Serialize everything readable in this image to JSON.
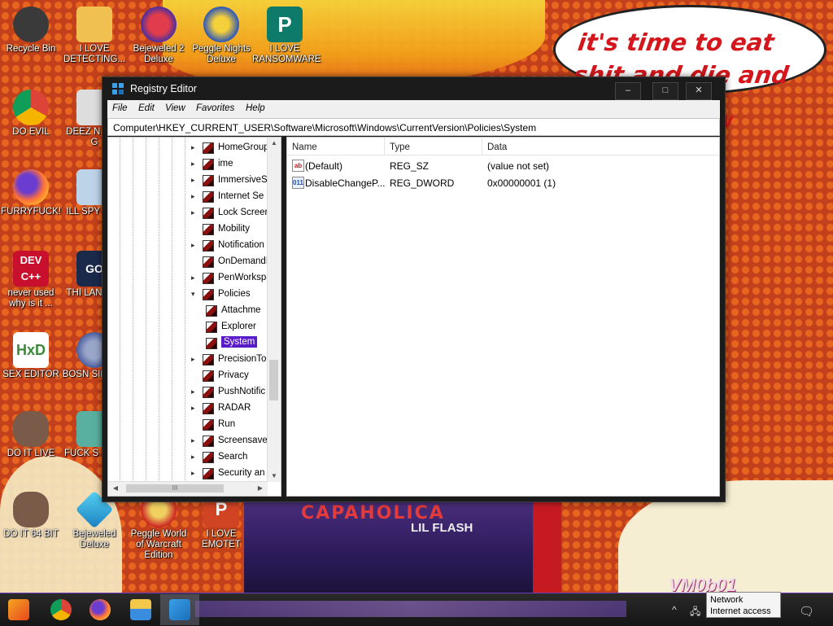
{
  "wallpaper": {
    "speech_bubble": "it's time to eat shit and die and chew",
    "speech_bubble_tail": "w",
    "poster_title": "CAPAHOLICA",
    "poster_subtitle": "LIL FLASH",
    "vm_label": "VM0b01"
  },
  "desktop_icons": [
    {
      "label": "Recycle Bin",
      "icon": "recycle-bin-icon"
    },
    {
      "label": "I LOVE DETECTING...",
      "icon": "detect-icon"
    },
    {
      "label": "Bejeweled 2 Deluxe",
      "icon": "bejeweled-icon"
    },
    {
      "label": "Peggle Nights Deluxe",
      "icon": "peggle-icon"
    },
    {
      "label": "I LOVE RANSOMWARE",
      "icon": "publisher-icon"
    },
    {
      "label": "DO EVIL",
      "icon": "chrome-icon"
    },
    {
      "label": "DEEZ N HAH G",
      "icon": "file-icon"
    },
    {
      "label": "FURRYFUCK!",
      "icon": "firefox-icon"
    },
    {
      "label": "ILL SPY YOU",
      "icon": "spy-icon"
    },
    {
      "label": "never used why is it ...",
      "icon": "devcpp-icon"
    },
    {
      "label": "THI LANGUA",
      "icon": "go-icon"
    },
    {
      "label": "SEX EDITOR",
      "icon": "hxd-icon"
    },
    {
      "label": "BOSN SIMULA",
      "icon": "virus-icon"
    },
    {
      "label": "DO IT LIVE",
      "icon": "portrait-icon"
    },
    {
      "label": "FUCK S ELVE",
      "icon": "elf-icon"
    },
    {
      "label": "DO IT 64 BIT",
      "icon": "portrait64-icon"
    },
    {
      "label": "Bejeweled Deluxe",
      "icon": "gem-icon"
    },
    {
      "label": "Peggle World of Warcraft Edition",
      "icon": "peggle-wow-icon"
    },
    {
      "label": "I LOVE EMOTET",
      "icon": "powerpoint-icon"
    }
  ],
  "window": {
    "title": "Registry Editor",
    "minimize": "‒",
    "maximize": "□",
    "close": "✕",
    "menu": [
      "File",
      "Edit",
      "View",
      "Favorites",
      "Help"
    ],
    "address": "Computer\\HKEY_CURRENT_USER\\Software\\Microsoft\\Windows\\CurrentVersion\\Policies\\System",
    "tree": [
      {
        "label": "HomeGroup",
        "expander": "▸",
        "child": false
      },
      {
        "label": "ime",
        "expander": "▸",
        "child": false
      },
      {
        "label": "ImmersiveS",
        "expander": "▸",
        "child": false
      },
      {
        "label": "Internet Se",
        "expander": "▸",
        "child": false
      },
      {
        "label": "Lock Screer",
        "expander": "▸",
        "child": false
      },
      {
        "label": "Mobility",
        "expander": "",
        "child": false
      },
      {
        "label": "Notification",
        "expander": "▸",
        "child": false
      },
      {
        "label": "OnDemandI",
        "expander": "",
        "child": false
      },
      {
        "label": "PenWorkspa",
        "expander": "▸",
        "child": false
      },
      {
        "label": "Policies",
        "expander": "▾",
        "child": false
      },
      {
        "label": "Attachme",
        "expander": "",
        "child": true
      },
      {
        "label": "Explorer",
        "expander": "",
        "child": true
      },
      {
        "label": "System",
        "expander": "",
        "child": true,
        "selected": true
      },
      {
        "label": "PrecisionTo",
        "expander": "▸",
        "child": false
      },
      {
        "label": "Privacy",
        "expander": "",
        "child": false
      },
      {
        "label": "PushNotific",
        "expander": "▸",
        "child": false
      },
      {
        "label": "RADAR",
        "expander": "▸",
        "child": false
      },
      {
        "label": "Run",
        "expander": "",
        "child": false
      },
      {
        "label": "Screensave",
        "expander": "▸",
        "child": false
      },
      {
        "label": "Search",
        "expander": "▸",
        "child": false
      },
      {
        "label": "Security an",
        "expander": "▸",
        "child": false
      }
    ],
    "columns": [
      "Name",
      "Type",
      "Data"
    ],
    "values": [
      {
        "icon": "ab",
        "name": "(Default)",
        "type": "REG_SZ",
        "data": "(value not set)"
      },
      {
        "icon": "011",
        "name": "DisableChangeP...",
        "type": "REG_DWORD",
        "data": "0x00000001 (1)"
      }
    ],
    "hscroll_grip": "III"
  },
  "taskbar": {
    "pinned": [
      "start-icon",
      "chrome-icon",
      "firefox-icon",
      "file-explorer-icon",
      "regedit-icon"
    ],
    "tray_notification": {
      "line1": "Network",
      "line2": "Internet access"
    }
  },
  "colors": {
    "selection": "#5a1cc9",
    "accent": "#6a3db8"
  }
}
